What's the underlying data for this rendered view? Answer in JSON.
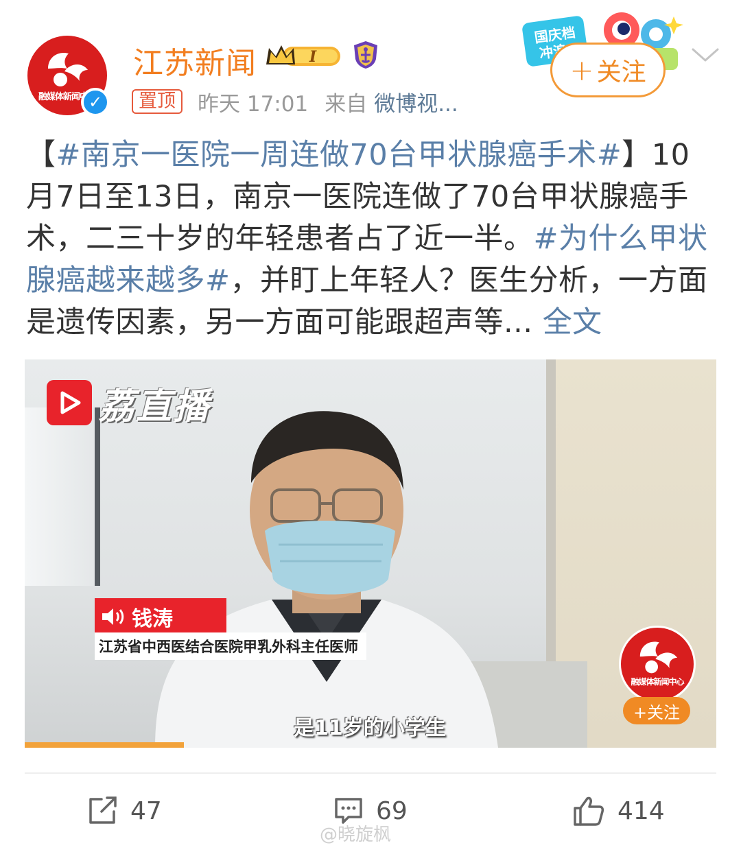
{
  "header": {
    "username": "江苏新闻",
    "level_badge": "I",
    "avatar_text": "融媒体新闻中心",
    "pin_label": "置顶",
    "time": "昨天 17:01",
    "from_label": "来自",
    "source": "微博视...",
    "promo_text": "国庆档冲浪",
    "follow_label": "关注",
    "follow_plus": "+"
  },
  "post": {
    "bracket_open": "【",
    "topic1": "#南京一医院一周连做70台甲状腺癌手术#",
    "bracket_close": "】",
    "text1": "10月7日至13日，南京一医院连做了70台甲状腺癌手术，二三十岁的年轻患者占了近一半。",
    "topic2": "#为什么甲状腺癌越来越多#",
    "text2": "，并盯上年轻人？医生分析，一方面是遗传因素，另一方面可能跟超声等",
    "ellipsis": "...",
    "more": "全文"
  },
  "video": {
    "brand": "荔直播",
    "speaker_name": "钱涛",
    "speaker_title": "江苏省中西医结合医院甲乳外科主任医师",
    "subtitle": "是11岁的小学生",
    "watermark_text": "融媒体新闻中心",
    "watermark_follow": "+关注",
    "progress": 0.23
  },
  "actions": {
    "share_count": "47",
    "comment_count": "69",
    "like_count": "414"
  },
  "footer": {
    "watermark": "@晓旋枫"
  },
  "colors": {
    "accent_orange": "#f08a24",
    "topic_blue": "#5a7fa8",
    "brand_red": "#d81e1e"
  }
}
